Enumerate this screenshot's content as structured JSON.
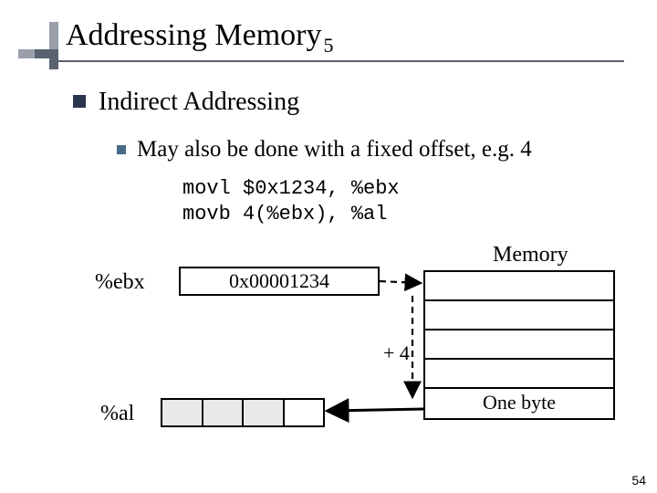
{
  "slide": {
    "title": "Addressing Memory",
    "title_subscript": "5",
    "page_number": "54"
  },
  "bullets": {
    "lvl1": "Indirect Addressing",
    "lvl2": "May also be done with a fixed offset, e.g. 4"
  },
  "code": {
    "line1": "movl $0x1234, %ebx",
    "line2": "movb 4(%ebx), %al"
  },
  "diagram": {
    "ebx_label": "%ebx",
    "al_label": "%al",
    "ebx_value": "0x00001234",
    "memory_heading": "Memory",
    "offset_label": "+ 4",
    "memory_row_label": "One byte"
  }
}
